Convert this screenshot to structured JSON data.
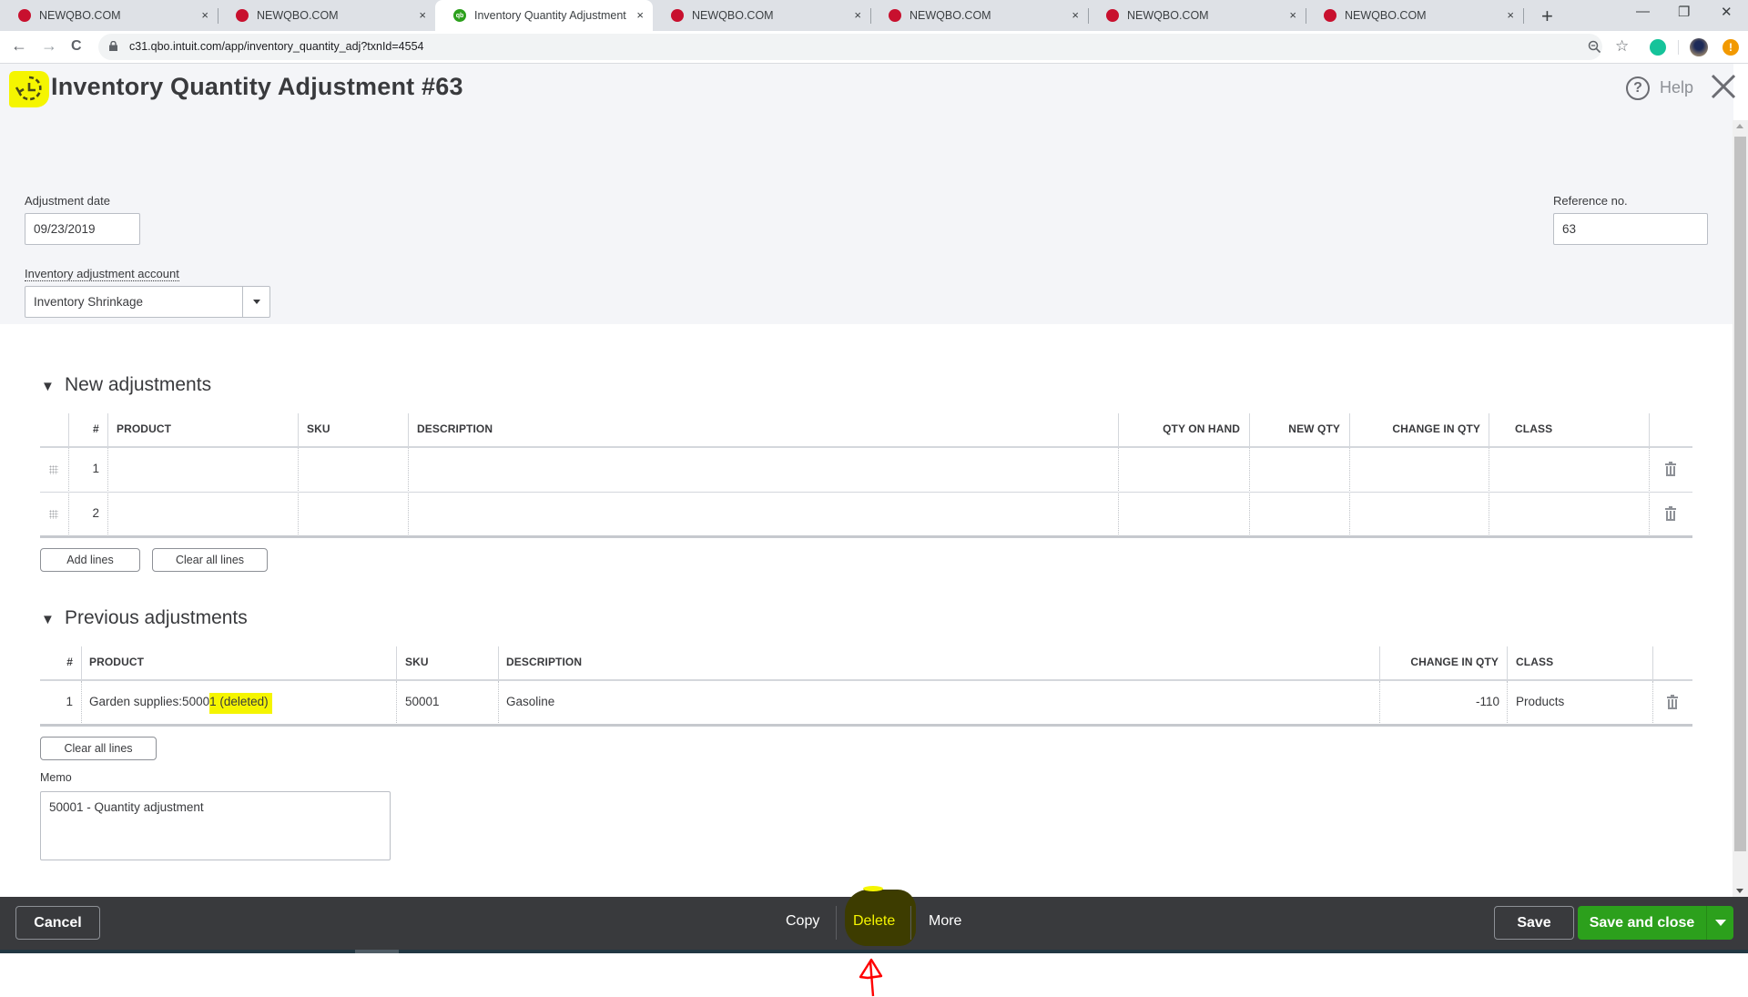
{
  "browser": {
    "tabs": [
      {
        "title": "NEWQBO.COM",
        "favicon": "newqbo-favicon",
        "active": false
      },
      {
        "title": "NEWQBO.COM",
        "favicon": "newqbo-favicon",
        "active": false
      },
      {
        "title": "Inventory Quantity Adjustment",
        "favicon": "quickbooks-favicon",
        "active": true
      },
      {
        "title": "NEWQBO.COM",
        "favicon": "newqbo-favicon",
        "active": false
      },
      {
        "title": "NEWQBO.COM",
        "favicon": "newqbo-favicon",
        "active": false
      },
      {
        "title": "NEWQBO.COM",
        "favicon": "newqbo-favicon",
        "active": false
      },
      {
        "title": "NEWQBO.COM",
        "favicon": "newqbo-favicon",
        "active": false
      }
    ],
    "new_tab_glyph": "+",
    "tab_close_glyph": "×",
    "window_controls": {
      "minimize": "—",
      "restore": "❐",
      "close": "✕"
    },
    "nav": {
      "back": "←",
      "forward": "→",
      "reload": "C"
    },
    "url": "c31.qbo.intuit.com/app/inventory_quantity_adj?txnId=4554",
    "qb_favicon_text": "qb"
  },
  "page": {
    "title": "Inventory Quantity Adjustment #63",
    "help_label": "Help",
    "help_glyph": "?",
    "adjustment_date": {
      "label": "Adjustment date",
      "value": "09/23/2019"
    },
    "reference_no": {
      "label": "Reference no.",
      "value": "63"
    },
    "adjustment_account": {
      "label": "Inventory adjustment account",
      "value": "Inventory Shrinkage"
    }
  },
  "new_adjustments": {
    "title": "New adjustments",
    "caret": "▼",
    "columns": [
      "#",
      "PRODUCT",
      "SKU",
      "DESCRIPTION",
      "QTY ON HAND",
      "NEW QTY",
      "CHANGE IN QTY",
      "CLASS"
    ],
    "rows": [
      {
        "num": "1",
        "product": "",
        "sku": "",
        "description": "",
        "qty_on_hand": "",
        "new_qty": "",
        "change_in_qty": "",
        "class": ""
      },
      {
        "num": "2",
        "product": "",
        "sku": "",
        "description": "",
        "qty_on_hand": "",
        "new_qty": "",
        "change_in_qty": "",
        "class": ""
      }
    ],
    "add_lines_label": "Add lines",
    "clear_lines_label": "Clear all lines"
  },
  "previous_adjustments": {
    "title": "Previous adjustments",
    "caret": "▼",
    "columns": [
      "#",
      "PRODUCT",
      "SKU",
      "DESCRIPTION",
      "CHANGE IN QTY",
      "CLASS"
    ],
    "rows": [
      {
        "num": "1",
        "product_main": "Garden supplies:5000",
        "product_highlighted": "1 (deleted)",
        "sku": "50001",
        "description": "Gasoline",
        "change_in_qty": "-110",
        "class": "Products"
      }
    ],
    "clear_lines_label": "Clear all lines"
  },
  "memo": {
    "label": "Memo",
    "value": "50001 - Quantity adjustment"
  },
  "footer": {
    "cancel_label": "Cancel",
    "copy_label": "Copy",
    "delete_label": "Delete",
    "more_label": "More",
    "save_label": "Save",
    "save_close_label": "Save and close"
  },
  "colors": {
    "primary_green": "#2ca01c",
    "footer_bg": "#393a3d",
    "highlight_yellow": "#f5f500",
    "annotation_red": "#ff0000"
  }
}
